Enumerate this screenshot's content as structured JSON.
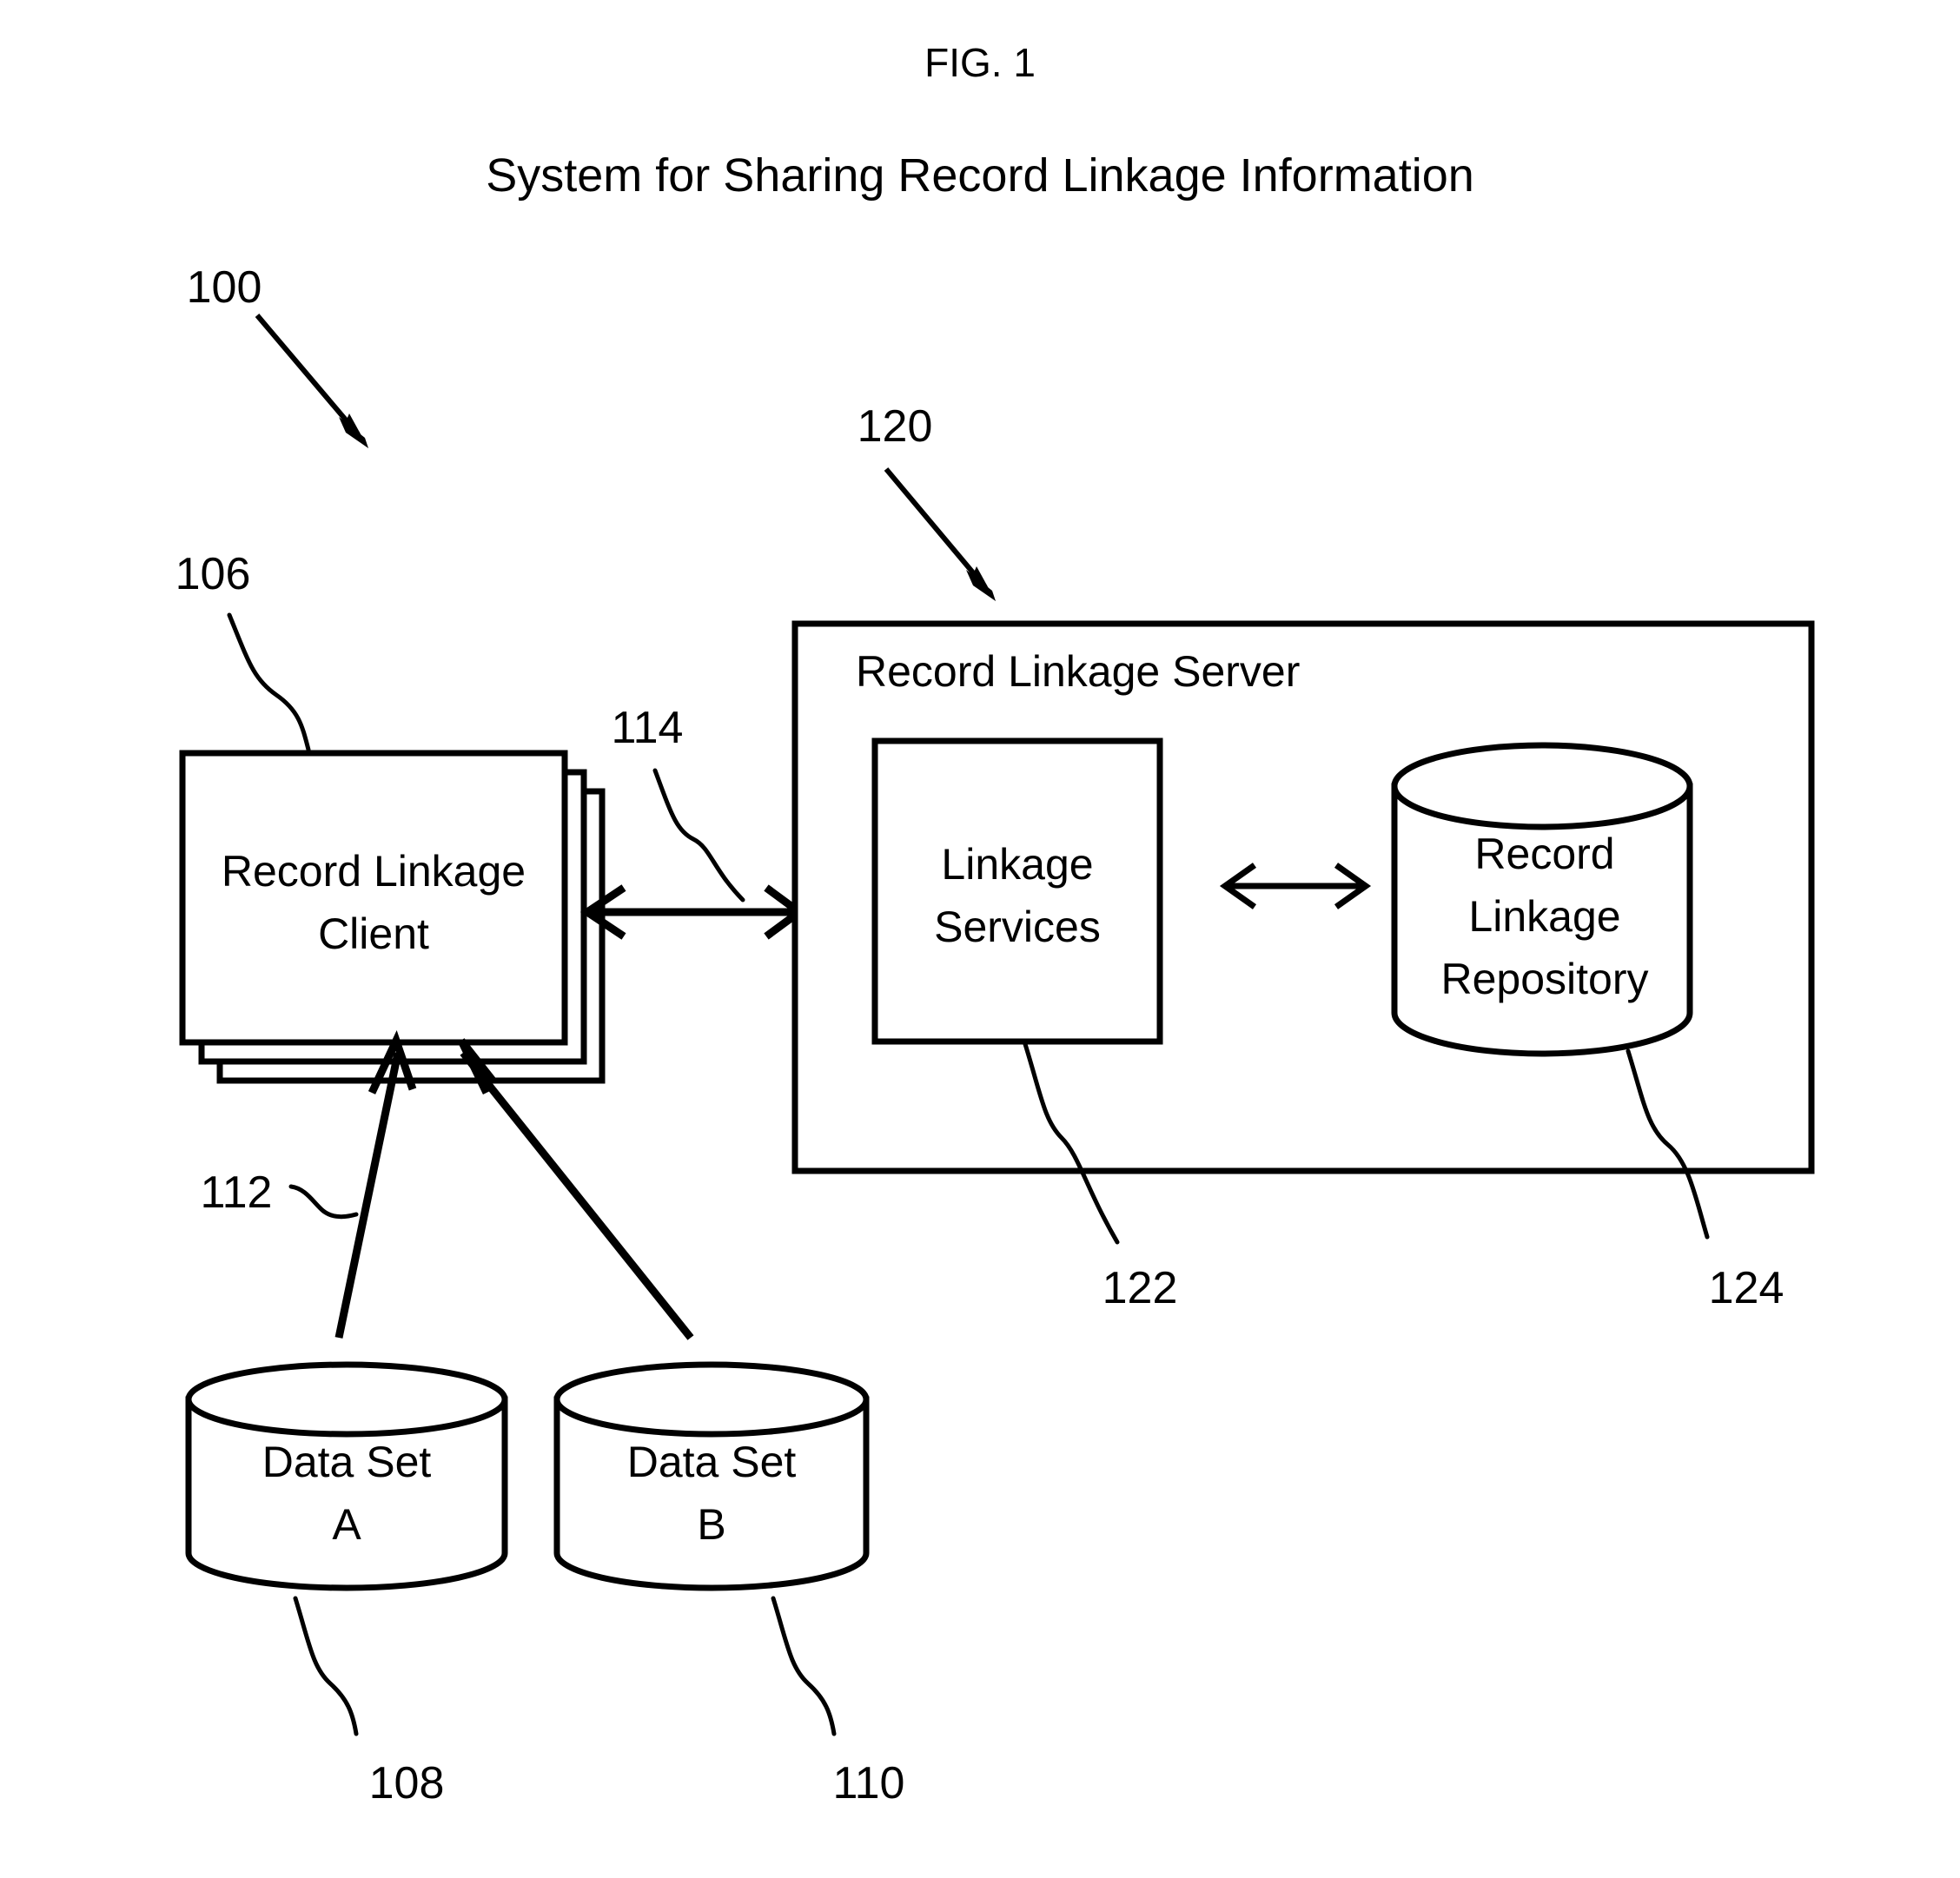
{
  "figure": {
    "figure_number": "FIG. 1",
    "title": "System for Sharing Record Linkage Information"
  },
  "nodes": {
    "client": {
      "label_line1": "Record Linkage",
      "label_line2": "Client",
      "ref": "106"
    },
    "server": {
      "label": "Record Linkage Server",
      "ref": "120"
    },
    "linkage_services": {
      "label_line1": "Linkage",
      "label_line2": "Services",
      "ref": "122"
    },
    "repository": {
      "label_line1": "Record",
      "label_line2": "Linkage",
      "label_line3": "Repository",
      "ref": "124"
    },
    "data_set_a": {
      "label_line1": "Data Set",
      "label_line2": "A",
      "ref": "108"
    },
    "data_set_b": {
      "label_line1": "Data Set",
      "label_line2": "B",
      "ref": "110"
    }
  },
  "reference_numerals": {
    "system": "100",
    "client": "106",
    "data_set_a": "108",
    "data_set_b": "110",
    "data_link": "112",
    "client_server_link": "114",
    "server": "120",
    "linkage_services": "122",
    "repository": "124"
  },
  "colors": {
    "stroke": "#000000",
    "background": "#ffffff"
  }
}
